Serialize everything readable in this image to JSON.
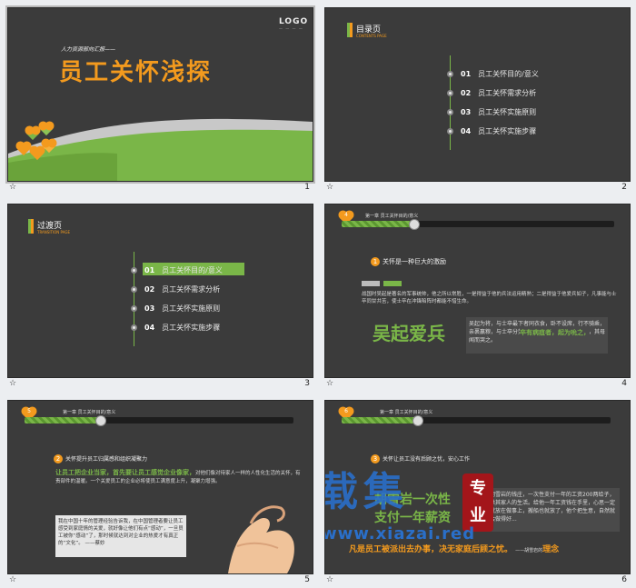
{
  "slides": [
    {
      "num": "1",
      "star": "☆",
      "logo": "LOGO",
      "subtitle": "人力资源部向汇报——",
      "title": "员工关怀浅探"
    },
    {
      "num": "2",
      "star": "☆",
      "section": "目录页",
      "section_en": "CONTENTS PAGE",
      "items": [
        {
          "n": "01",
          "t": "员工关怀目的/意义"
        },
        {
          "n": "02",
          "t": "员工关怀需求分析"
        },
        {
          "n": "03",
          "t": "员工关怀实施原则"
        },
        {
          "n": "04",
          "t": "员工关怀实施步骤"
        }
      ]
    },
    {
      "num": "3",
      "star": "☆",
      "section": "过渡页",
      "section_en": "TRANSITION PAGE",
      "items": [
        {
          "n": "01",
          "t": "员工关怀目的/意义"
        },
        {
          "n": "02",
          "t": "员工关怀需求分析"
        },
        {
          "n": "03",
          "t": "员工关怀实施原则"
        },
        {
          "n": "04",
          "t": "员工关怀实施步骤"
        }
      ]
    },
    {
      "num": "4",
      "star": "☆",
      "badge": "4",
      "bar_label": "第一章 员工关怀目的/意义",
      "point": "关怀是一种巨大的激励",
      "body": "战国时吴起是著名的军事统帅，他之所以常胜，一是得益于他的兵法运用精熟；二是得益于他爱兵如子，凡事能与士卒同甘共苦，使士卒在冲锋陷阵时都能不惜生命。",
      "big": "吴起爱兵",
      "quote": "吴起为将，与士卒最下者同衣食，卧不设席，行不骑乘，亲裹赢粮，与士卒分劳苦。卒有病疽者，起为吮之，其母闻而哭之。",
      "quote_hl": "卒有病疽者，起为吮之，"
    },
    {
      "num": "5",
      "star": "☆",
      "badge": "5",
      "bar_label": "第一章 员工关怀目的/意义",
      "point": "关怀提升员工归属感和组织凝聚力",
      "body_hl": "让员工把企业当家，首先要让员工感觉企业像家，",
      "body": "对他们像对待家人一样的人性化生活的关怀，有责部件的温暖。一个关爱员工的企业必将使员工满意度上升，凝聚力增强。",
      "quote": "我在中国十年的管理经验告诉我，在中国管理者要让员工感受到家庭情的关爱，就好像让他们有点“感动”，一旦员工被你“感动”了，那时候就达到对企业的热爱才有真正的“文化”。                    ——蔡妙"
    },
    {
      "num": "6",
      "star": "☆",
      "badge": "6",
      "bar_label": "第一章 员工关怀目的/意义",
      "point": "关怀让员工没有后顾之忧，安心工作",
      "green1": "胡雪岩一次性",
      "green2": "支付一年薪资",
      "side": "胡雪岩的钱庄，一次性支付一年的工资200两给子，供其家人的生活。给他一年工资钱在手里，心思一定就放在做事上，搬船也就放了，他个把生意，自然就会做得好...",
      "bottom": "凡是员工被派出去办事，决无家庭后顾之忧。",
      "bottom_sig": "——胡雪岩的",
      "bottom_end": "理念",
      "wm1": "下载集",
      "wm_tag": "专业",
      "wm2": "www.xiazai.red"
    }
  ]
}
